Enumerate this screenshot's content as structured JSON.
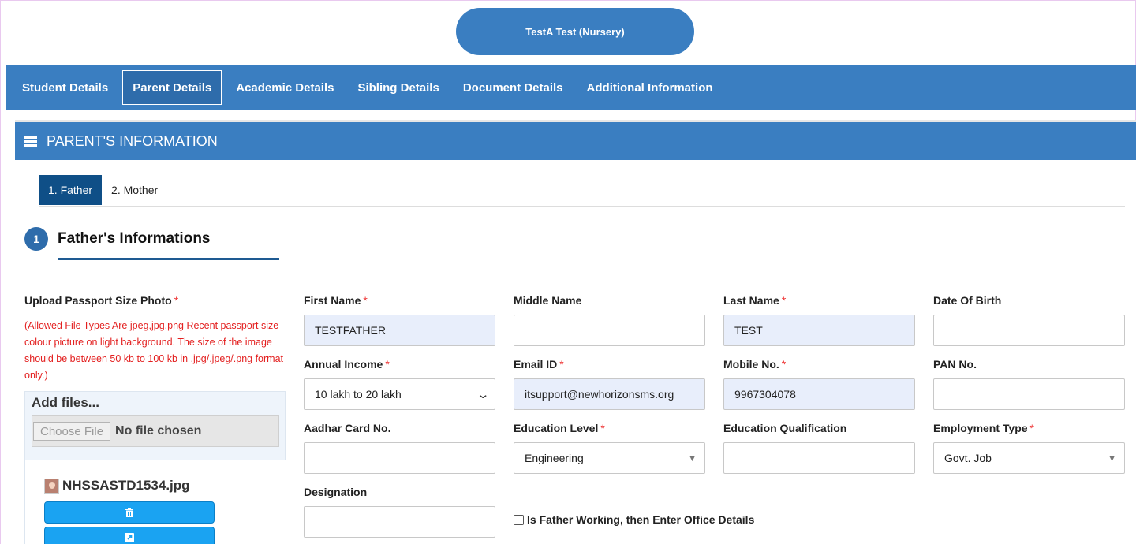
{
  "header": {
    "student_name": "TestA Test (Nursery)"
  },
  "nav": {
    "tabs": [
      "Student Details",
      "Parent Details",
      "Academic Details",
      "Sibling Details",
      "Document Details",
      "Additional Information"
    ],
    "active_index": 1
  },
  "panel": {
    "title": "PARENT'S INFORMATION",
    "subtabs": [
      "1. Father",
      "2. Mother"
    ],
    "section_number": "1",
    "section_title": "Father's Informations"
  },
  "photo": {
    "label": "Upload Passport Size Photo",
    "note": "(Allowed File Types Are jpeg,jpg,png Recent passport size colour picture on light background. The size of the image should be between 50 kb to 100 kb in .jpg/.jpeg/.png format only.)",
    "add_files": "Add files...",
    "choose_file": "Choose File",
    "no_file": "No file chosen",
    "uploaded_file": "NHSSASTD1534.jpg",
    "delete_icon": "trash-icon",
    "edit_icon": "external-link-icon"
  },
  "fields": {
    "first_name": {
      "label": "First Name",
      "value": "TESTFATHER",
      "required": "*"
    },
    "middle_name": {
      "label": "Middle Name",
      "value": ""
    },
    "last_name": {
      "label": "Last Name",
      "value": "TEST",
      "required": "*"
    },
    "dob": {
      "label": "Date Of Birth",
      "value": ""
    },
    "annual_income": {
      "label": "Annual Income",
      "value": "10 lakh to 20 lakh",
      "required": "*"
    },
    "email": {
      "label": "Email ID",
      "value": "itsupport@newhorizonsms.org",
      "required": "*"
    },
    "mobile": {
      "label": "Mobile No.",
      "value": "9967304078",
      "required": "*"
    },
    "pan": {
      "label": "PAN No.",
      "value": ""
    },
    "aadhar": {
      "label": "Aadhar Card No.",
      "value": ""
    },
    "education_level": {
      "label": "Education Level",
      "value": "Engineering",
      "required": "*"
    },
    "education_qualification": {
      "label": "Education Qualification",
      "value": ""
    },
    "employment_type": {
      "label": "Employment Type",
      "value": "Govt. Job",
      "required": "*"
    },
    "designation": {
      "label": "Designation",
      "value": ""
    }
  },
  "working_checkbox": {
    "label": "Is Father Working, then Enter Office Details",
    "checked": false
  },
  "colors": {
    "primary": "#3a7ec1",
    "active_subtab": "#0f4f87",
    "required": "#e33333",
    "note": "#e32020",
    "button": "#1aa3f2"
  }
}
